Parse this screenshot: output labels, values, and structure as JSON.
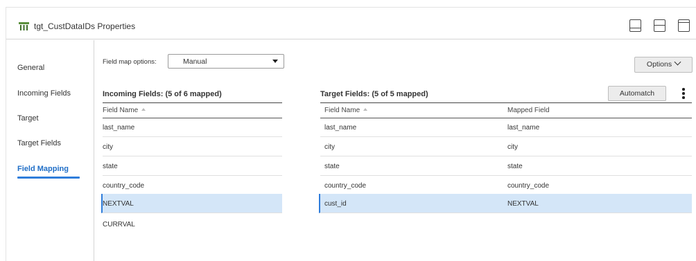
{
  "panel": {
    "title": "tgt_CustDataIDs Properties"
  },
  "nav": {
    "items": [
      {
        "label": "General"
      },
      {
        "label": "Incoming Fields"
      },
      {
        "label": "Target"
      },
      {
        "label": "Target Fields"
      },
      {
        "label": "Field Mapping"
      }
    ],
    "active": "Field Mapping"
  },
  "field_map": {
    "label": "Field map options:",
    "value": "Manual"
  },
  "buttons": {
    "options": "Options",
    "automatch": "Automatch"
  },
  "incoming": {
    "title": "Incoming Fields: (5 of 6 mapped)",
    "col_field_name": "Field Name",
    "rows": [
      "last_name",
      "city",
      "state",
      "country_code",
      "NEXTVAL",
      "CURRVAL"
    ],
    "selected_row": "NEXTVAL"
  },
  "target": {
    "title": "Target Fields: (5 of 5 mapped)",
    "col_field_name": "Field Name",
    "col_mapped_field": "Mapped Field",
    "rows": [
      {
        "field": "last_name",
        "mapped": "last_name"
      },
      {
        "field": "city",
        "mapped": "city"
      },
      {
        "field": "state",
        "mapped": "state"
      },
      {
        "field": "country_code",
        "mapped": "country_code"
      },
      {
        "field": "cust_id",
        "mapped": "NEXTVAL"
      }
    ],
    "selected_row": "cust_id"
  },
  "colors": {
    "accent": "#2f7ddb",
    "active_nav": "#1f6ec7",
    "selected_row_bg": "#d4e6f8"
  },
  "icons": [
    "table-target-icon",
    "panel-bottom-icon",
    "panel-split-icon",
    "panel-top-icon",
    "chevron-down-icon",
    "kebab-menu-icon",
    "sort-asc-icon",
    "dropdown-caret-icon"
  ]
}
